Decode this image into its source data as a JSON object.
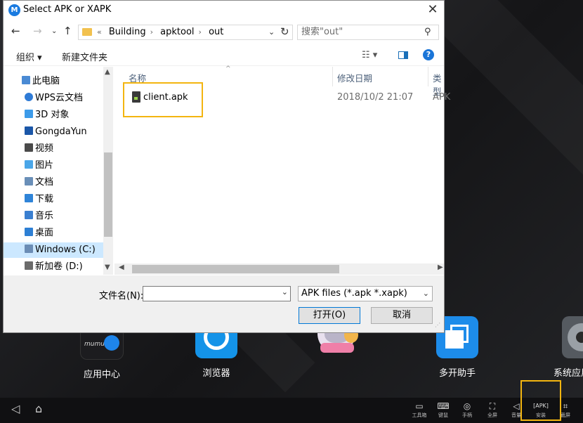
{
  "dialog": {
    "title": "Select APK or XAPK",
    "address": {
      "prefix": "«",
      "crumbs": [
        "Building",
        "apktool",
        "out"
      ]
    },
    "search_placeholder": "搜索\"out\"",
    "toolbar": {
      "organize": "组织 ▾",
      "new_folder": "新建文件夹",
      "view_icon": "☷ ▾",
      "help": "?"
    },
    "nav_items": [
      {
        "label": "此电脑",
        "icon": "computer-icon",
        "color": "#4a8ad4"
      },
      {
        "label": "WPS云文档",
        "icon": "cloud-icon",
        "color": "#2f7bd6"
      },
      {
        "label": "3D 对象",
        "icon": "3d-objects-icon",
        "color": "#3d9be9"
      },
      {
        "label": "GongdaYun",
        "icon": "gongdayun-icon",
        "color": "#1b57a8"
      },
      {
        "label": "视频",
        "icon": "video-icon",
        "color": "#4a4a4a"
      },
      {
        "label": "图片",
        "icon": "picture-icon",
        "color": "#4aa6e8"
      },
      {
        "label": "文档",
        "icon": "document-icon",
        "color": "#6a8fb8"
      },
      {
        "label": "下载",
        "icon": "download-icon",
        "color": "#2f84d8"
      },
      {
        "label": "音乐",
        "icon": "music-icon",
        "color": "#3a7fd0"
      },
      {
        "label": "桌面",
        "icon": "desktop-icon",
        "color": "#2d7fd4"
      },
      {
        "label": "Windows (C:)",
        "icon": "drive-c-icon",
        "color": "#6b8db5"
      },
      {
        "label": "新加卷 (D:)",
        "icon": "drive-d-icon",
        "color": "#6b6b6b"
      }
    ],
    "columns": [
      "名称",
      "修改日期",
      "类型"
    ],
    "files": [
      {
        "name": "client.apk",
        "modified": "2018/10/2 21:07",
        "type": "APK"
      }
    ],
    "filename_label": "文件名(N):",
    "filename_value": "",
    "filter": "APK files (*.apk *.xapk)",
    "open_label": "打开(O)",
    "cancel_label": "取消"
  },
  "apps": [
    {
      "label": "应用中心",
      "icon": "app-center-icon"
    },
    {
      "label": "浏览器",
      "icon": "browser-icon"
    },
    {
      "label": "",
      "icon": "anime-character-icon"
    },
    {
      "label": "多开助手",
      "icon": "multi-instance-icon"
    },
    {
      "label": "系统应用",
      "icon": "system-apps-icon"
    }
  ],
  "app_center_badge": "mumu",
  "bottom_tools": [
    {
      "label": "工具箱",
      "icon": "toolbox-icon"
    },
    {
      "label": "键鼠",
      "icon": "keyboard-icon"
    },
    {
      "label": "手柄",
      "icon": "gamepad-icon"
    },
    {
      "label": "全屏",
      "icon": "fullscreen-icon"
    },
    {
      "label": "音量",
      "icon": "volume-icon"
    },
    {
      "label": "安装",
      "icon": "install-apk-icon"
    },
    {
      "label": "截屏",
      "icon": "screenshot-icon"
    }
  ],
  "colors": {
    "highlight": "#f3b510",
    "accent": "#0078d7"
  }
}
